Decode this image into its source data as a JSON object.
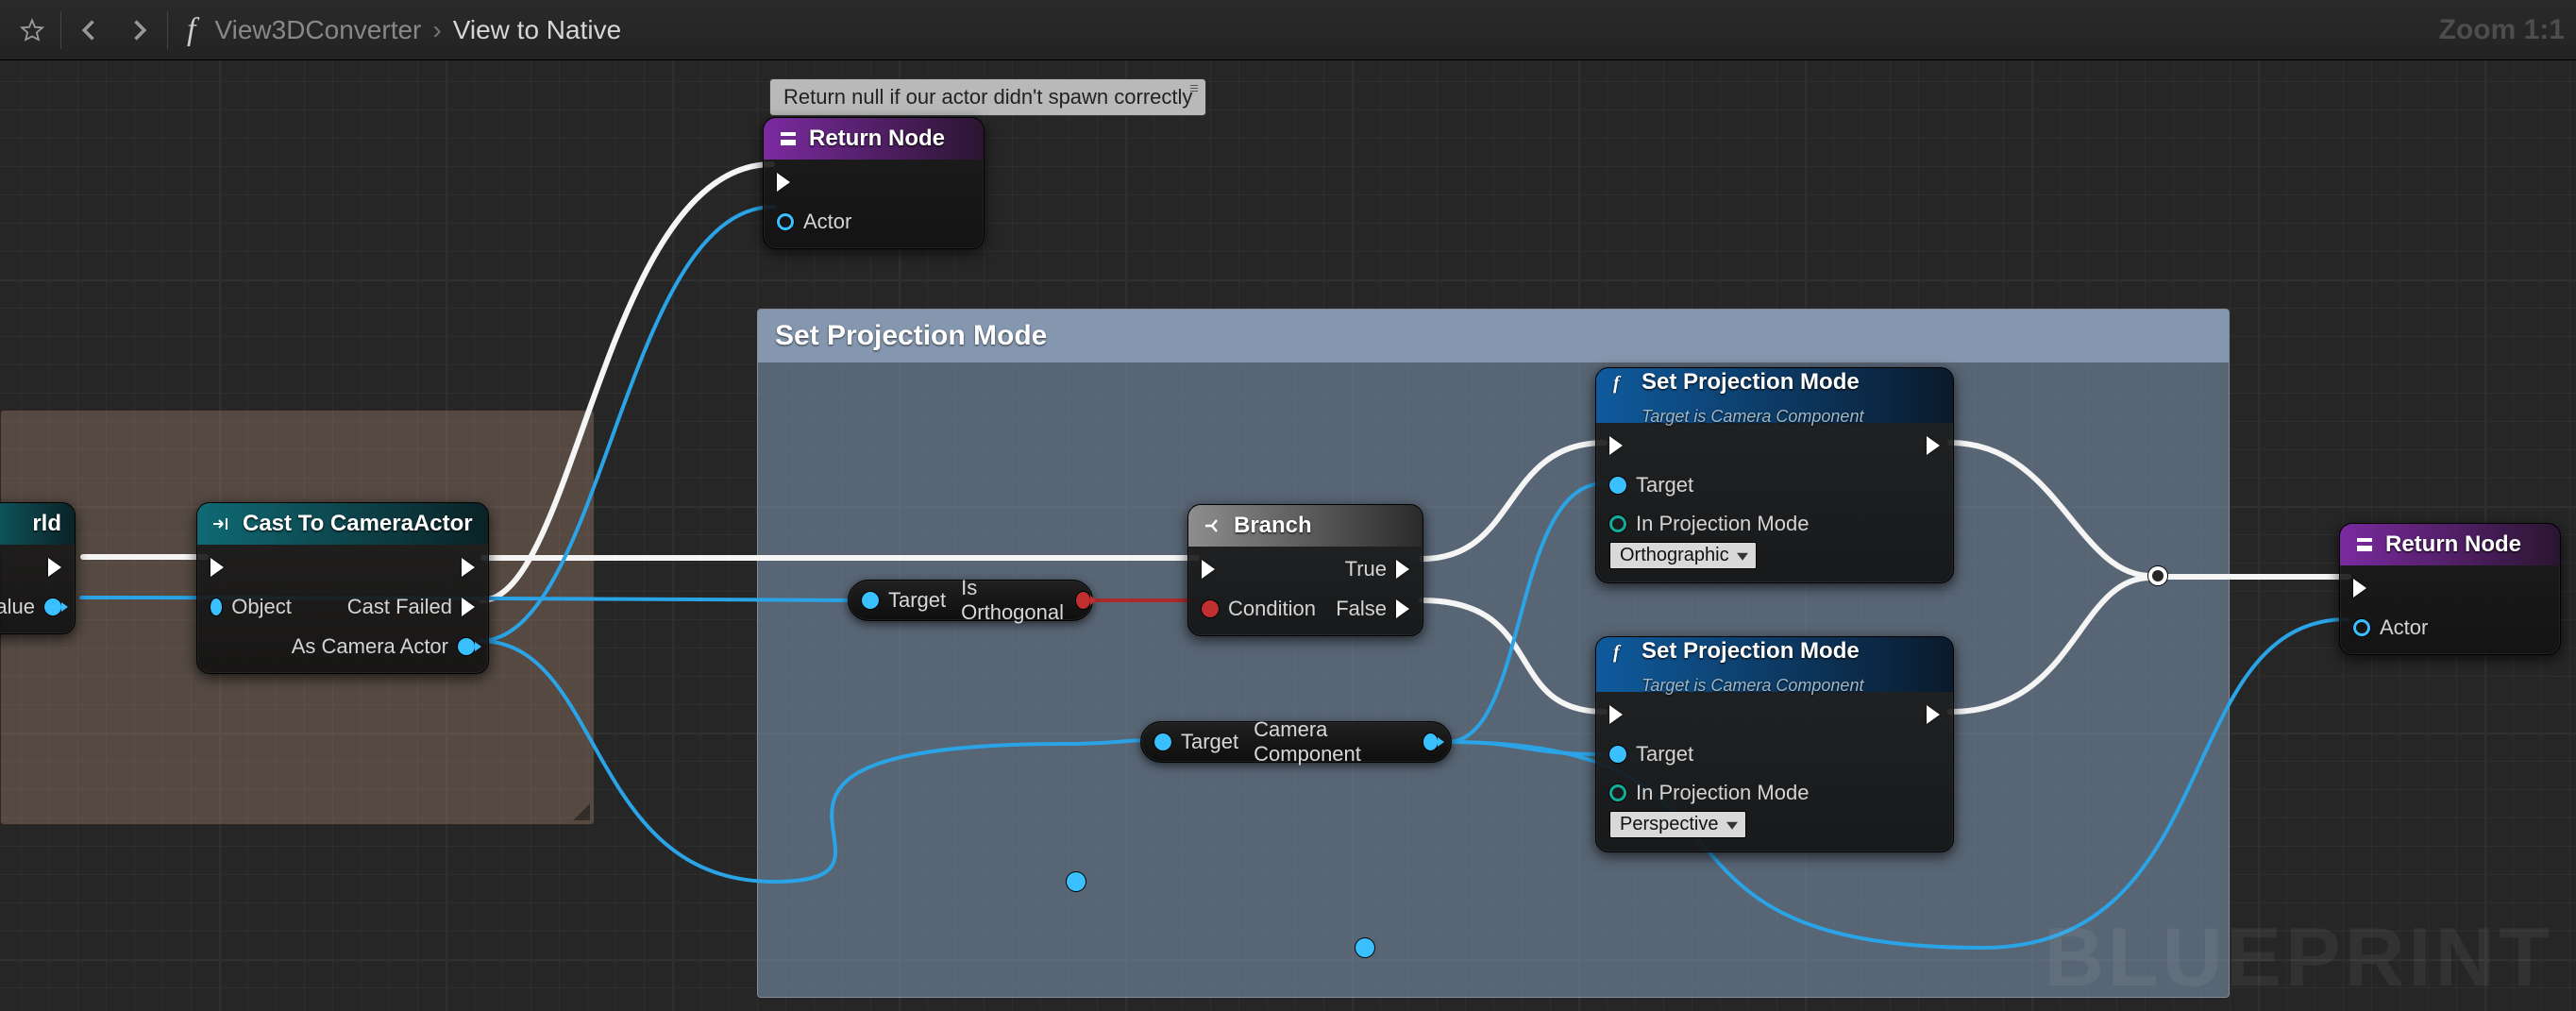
{
  "toolbar": {
    "breadcrumb_root": "View3DConverter",
    "breadcrumb_current": "View to Native",
    "zoom": "Zoom 1:1"
  },
  "watermark": "BLUEPRINT",
  "comment_nospawn": {
    "tooltip": "Return null if our actor didn't spawn correctly"
  },
  "comment_main": {
    "title": "Set Projection Mode"
  },
  "nodes": {
    "world": {
      "out_exec": "",
      "out_value": "rn Value"
    },
    "cast": {
      "title": "Cast To CameraActor",
      "in_object": "Object",
      "out_fail": "Cast Failed",
      "out_actor": "As Camera Actor"
    },
    "return1": {
      "title": "Return Node",
      "in_actor": "Actor"
    },
    "return2": {
      "title": "Return Node",
      "in_actor": "Actor"
    },
    "branch": {
      "title": "Branch",
      "in_cond": "Condition",
      "out_true": "True",
      "out_false": "False"
    },
    "isortho": {
      "left": "Target",
      "right": "Is Orthogonal"
    },
    "camcomp": {
      "left": "Target",
      "right": "Camera Component"
    },
    "setproj1": {
      "title": "Set Projection Mode",
      "subtitle": "Target is Camera Component",
      "pin_target": "Target",
      "pin_mode": "In Projection Mode",
      "dropdown": "Orthographic"
    },
    "setproj2": {
      "title": "Set Projection Mode",
      "subtitle": "Target is Camera Component",
      "pin_target": "Target",
      "pin_mode": "In Projection Mode",
      "dropdown": "Perspective"
    }
  }
}
